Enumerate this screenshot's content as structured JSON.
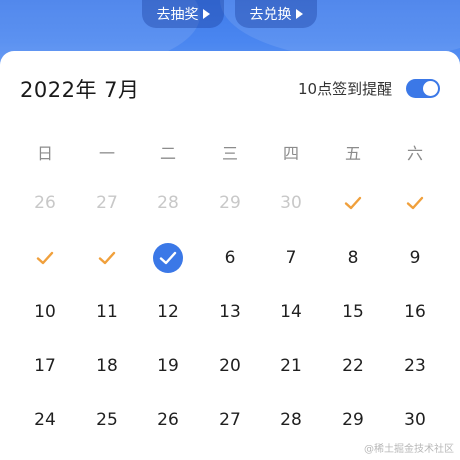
{
  "header": {
    "lottery_button": "去抽奖",
    "exchange_button": "去兑换"
  },
  "calendar": {
    "month_title": "2022年 7月",
    "reminder_label": "10点签到提醒",
    "reminder_enabled": true,
    "weekdays": [
      "日",
      "一",
      "二",
      "三",
      "四",
      "五",
      "六"
    ],
    "rows": [
      [
        {
          "label": "26",
          "state": "outside"
        },
        {
          "label": "27",
          "state": "outside"
        },
        {
          "label": "28",
          "state": "outside"
        },
        {
          "label": "29",
          "state": "outside"
        },
        {
          "label": "30",
          "state": "outside"
        },
        {
          "label": "",
          "state": "checked"
        },
        {
          "label": "",
          "state": "checked"
        }
      ],
      [
        {
          "label": "",
          "state": "checked"
        },
        {
          "label": "",
          "state": "checked"
        },
        {
          "label": "",
          "state": "selected"
        },
        {
          "label": "6",
          "state": "normal"
        },
        {
          "label": "7",
          "state": "normal"
        },
        {
          "label": "8",
          "state": "normal"
        },
        {
          "label": "9",
          "state": "normal"
        }
      ],
      [
        {
          "label": "10",
          "state": "normal"
        },
        {
          "label": "11",
          "state": "normal"
        },
        {
          "label": "12",
          "state": "normal"
        },
        {
          "label": "13",
          "state": "normal"
        },
        {
          "label": "14",
          "state": "normal"
        },
        {
          "label": "15",
          "state": "normal"
        },
        {
          "label": "16",
          "state": "normal"
        }
      ],
      [
        {
          "label": "17",
          "state": "normal"
        },
        {
          "label": "18",
          "state": "normal"
        },
        {
          "label": "19",
          "state": "normal"
        },
        {
          "label": "20",
          "state": "normal"
        },
        {
          "label": "21",
          "state": "normal"
        },
        {
          "label": "22",
          "state": "normal"
        },
        {
          "label": "23",
          "state": "normal"
        }
      ],
      [
        {
          "label": "24",
          "state": "normal"
        },
        {
          "label": "25",
          "state": "normal"
        },
        {
          "label": "26",
          "state": "normal"
        },
        {
          "label": "27",
          "state": "normal"
        },
        {
          "label": "28",
          "state": "normal"
        },
        {
          "label": "29",
          "state": "normal"
        },
        {
          "label": "30",
          "state": "normal"
        }
      ]
    ]
  },
  "colors": {
    "accent": "#3b78e7",
    "checkmark": "#f0a03c",
    "outside_day": "#c8c8c8"
  },
  "watermark": "@稀土掘金技术社区"
}
